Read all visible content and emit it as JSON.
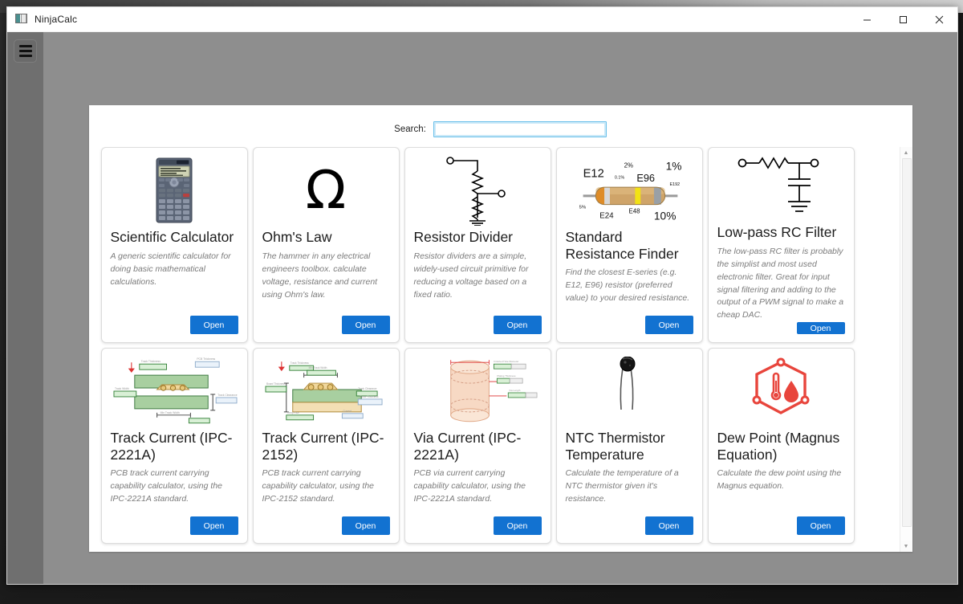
{
  "window": {
    "title": "NinjaCalc",
    "icon": "app-icon",
    "controls": {
      "minimize": "minimize-icon",
      "maximize": "maximize-icon",
      "close": "close-icon"
    }
  },
  "sidebar": {
    "menu_button": "hamburger-icon"
  },
  "search": {
    "label": "Search:",
    "value": "",
    "placeholder": ""
  },
  "scrollbar": {
    "up": "▲",
    "down": "▼"
  },
  "open_label": "Open",
  "cards": [
    {
      "id": "scientific-calculator",
      "icon": "scientific-calculator-image",
      "title": "Scientific Calculator",
      "desc": "A generic scientific calculator for doing basic mathematical calculations.",
      "button": "Open"
    },
    {
      "id": "ohms-law",
      "icon": "omega-symbol",
      "symbol": "Ω",
      "title": "Ohm's Law",
      "desc": "The hammer in any electrical engineers toolbox. calculate voltage, resistance and current using Ohm's law.",
      "button": "Open"
    },
    {
      "id": "resistor-divider",
      "icon": "resistor-divider-schematic",
      "title": "Resistor Divider",
      "desc": "Resistor dividers are a simple, widely-used circuit primitive for reducing a voltage based on a fixed ratio.",
      "button": "Open"
    },
    {
      "id": "standard-resistance-finder",
      "icon": "resistor-photo",
      "title": "Standard Resistance Finder",
      "desc": "Find the closest E-series (e.g. E12, E96) resistor (preferred value) to your desired resistance.",
      "button": "Open",
      "image_labels": [
        "E12",
        "2%",
        "1%",
        "0.1%",
        "E96",
        "E192",
        "5%",
        "E24",
        "E48",
        "10%"
      ]
    },
    {
      "id": "low-pass-rc-filter",
      "icon": "rc-filter-schematic",
      "title": "Low-pass RC Filter",
      "desc": "The low-pass RC filter is probably the simplist and most used electronic filter. Great for input signal filtering and adding to the output of a PWM signal to make a cheap DAC.",
      "button": "Open"
    },
    {
      "id": "track-current-ipc-2221a",
      "icon": "pcb-internal-track-diagram",
      "title": "Track Current (IPC-2221A)",
      "desc": "PCB track current carrying capability calculator, using the IPC-2221A standard.",
      "button": "Open"
    },
    {
      "id": "track-current-ipc-2152",
      "icon": "pcb-external-track-diagram",
      "title": "Track Current (IPC-2152)",
      "desc": "PCB track current carrying capability calculator, using the IPC-2152 standard.",
      "button": "Open"
    },
    {
      "id": "via-current-ipc-2221a",
      "icon": "pcb-via-diagram",
      "title": "Via Current (IPC-2221A)",
      "desc": "PCB via current carrying capability calculator, using the IPC-2221A standard.",
      "button": "Open"
    },
    {
      "id": "ntc-thermistor-temperature",
      "icon": "ntc-thermistor-photo",
      "title": "NTC Thermistor Temperature",
      "desc": "Calculate the temperature of a NTC thermistor given it's resistance.",
      "button": "Open"
    },
    {
      "id": "dew-point-magnus",
      "icon": "dew-point-icon",
      "title": "Dew Point (Magnus Equation)",
      "desc": "Calculate the dew point using the Magnus equation.",
      "button": "Open"
    }
  ],
  "colors": {
    "accent": "#1272d1",
    "window_body": "#8e8e8e",
    "sidebar": "#6f6f6f",
    "focus_border": "#6cc0ea"
  }
}
